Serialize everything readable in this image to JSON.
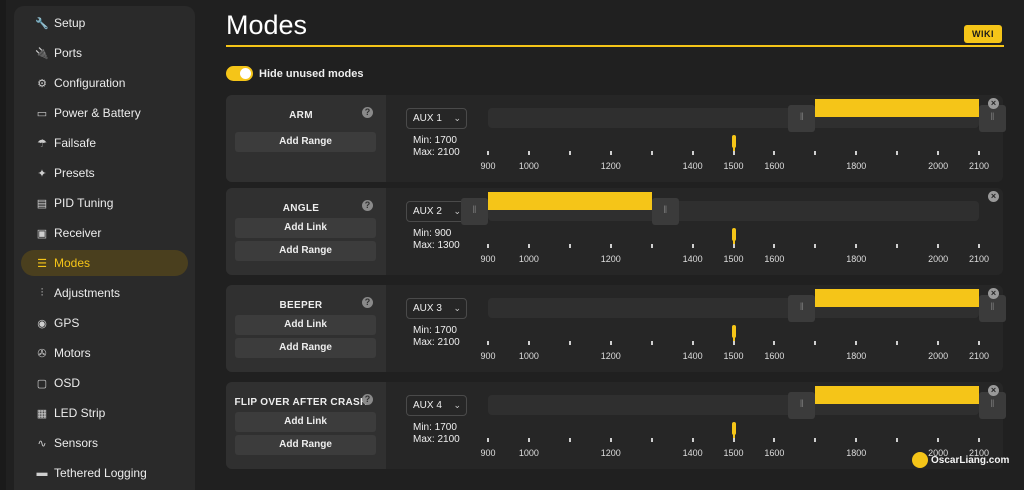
{
  "sidebar": {
    "items": [
      {
        "label": "Setup",
        "icon": "wrench-icon",
        "glyph": "🔧",
        "active": false
      },
      {
        "label": "Ports",
        "icon": "plug-icon",
        "glyph": "🔌",
        "active": false
      },
      {
        "label": "Configuration",
        "icon": "gear-icon",
        "glyph": "⚙",
        "active": false
      },
      {
        "label": "Power & Battery",
        "icon": "battery-icon",
        "glyph": "▭",
        "active": false
      },
      {
        "label": "Failsafe",
        "icon": "parachute-icon",
        "glyph": "☂",
        "active": false
      },
      {
        "label": "Presets",
        "icon": "magic-wand-icon",
        "glyph": "✦",
        "active": false
      },
      {
        "label": "PID Tuning",
        "icon": "pid-icon",
        "glyph": "▤",
        "active": false
      },
      {
        "label": "Receiver",
        "icon": "receiver-icon",
        "glyph": "▣",
        "active": false
      },
      {
        "label": "Modes",
        "icon": "toggles-icon",
        "glyph": "☰",
        "active": true
      },
      {
        "label": "Adjustments",
        "icon": "sliders-icon",
        "glyph": "⫶",
        "active": false
      },
      {
        "label": "GPS",
        "icon": "globe-icon",
        "glyph": "◉",
        "active": false
      },
      {
        "label": "Motors",
        "icon": "motor-icon",
        "glyph": "✇",
        "active": false
      },
      {
        "label": "OSD",
        "icon": "osd-icon",
        "glyph": "▢",
        "active": false
      },
      {
        "label": "LED Strip",
        "icon": "led-icon",
        "glyph": "▦",
        "active": false
      },
      {
        "label": "Sensors",
        "icon": "pulse-icon",
        "glyph": "∿",
        "active": false
      },
      {
        "label": "Tethered Logging",
        "icon": "log-icon",
        "glyph": "▬",
        "active": false
      }
    ]
  },
  "page": {
    "title": "Modes",
    "wiki_label": "WIKI",
    "hide_unused_label": "Hide unused modes",
    "hide_unused_on": true
  },
  "scale_ticks": [
    "900",
    "1000",
    "1200",
    "1400",
    "1500",
    "1600",
    "1800",
    "2000",
    "2100"
  ],
  "channel_marker_value": 1500,
  "accent_color": "#f5c518",
  "modes": [
    {
      "name": "ARM",
      "aux": "AUX 1",
      "min_label": "Min: 1700",
      "max_label": "Max: 2100",
      "range_min": 1700,
      "range_max": 2100,
      "buttons": [
        "Add Range"
      ]
    },
    {
      "name": "ANGLE",
      "aux": "AUX 2",
      "min_label": "Min: 900",
      "max_label": "Max: 1300",
      "range_min": 900,
      "range_max": 1300,
      "buttons": [
        "Add Link",
        "Add Range"
      ]
    },
    {
      "name": "BEEPER",
      "aux": "AUX 3",
      "min_label": "Min: 1700",
      "max_label": "Max: 2100",
      "range_min": 1700,
      "range_max": 2100,
      "buttons": [
        "Add Link",
        "Add Range"
      ]
    },
    {
      "name": "FLIP OVER AFTER CRASH",
      "aux": "AUX 4",
      "min_label": "Min: 1700",
      "max_label": "Max: 2100",
      "range_min": 1700,
      "range_max": 2100,
      "buttons": [
        "Add Link",
        "Add Range"
      ]
    }
  ],
  "watermark": "OscarLiang.com"
}
